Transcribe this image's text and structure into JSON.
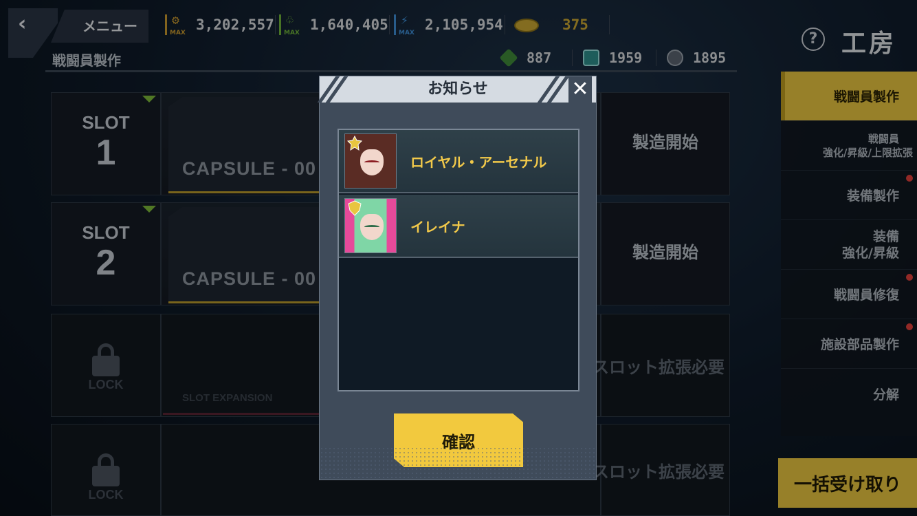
{
  "header": {
    "menu_label": "メニュー",
    "page_title": "工房",
    "subtitle": "戦闘員製作",
    "resources": [
      {
        "icon": "gear-resource-icon",
        "value": "3,202,557",
        "max": "MAX",
        "color": "#c99a2e"
      },
      {
        "icon": "plant-resource-icon",
        "value": "1,640,405",
        "max": "MAX",
        "color": "#6fb23a"
      },
      {
        "icon": "fuel-resource-icon",
        "value": "2,105,954",
        "max": "MAX",
        "color": "#3e8ed6"
      },
      {
        "icon": "coin-icon",
        "value": "375",
        "color": "#c9a632"
      }
    ],
    "resources2": [
      {
        "icon": "green-crystal-icon",
        "value": "887"
      },
      {
        "icon": "chip-icon",
        "value": "1959"
      },
      {
        "icon": "capsule-icon",
        "value": "1895"
      }
    ]
  },
  "slots": [
    {
      "label": "SLOT",
      "number": "1",
      "capsule": "CAPSULE - 00",
      "action": "製造開始"
    },
    {
      "label": "SLOT",
      "number": "2",
      "capsule": "CAPSULE - 00",
      "action": "製造開始"
    },
    {
      "lock": "LOCK",
      "expansion": "SLOT EXPANSION",
      "need": "スロット拡張必要"
    },
    {
      "lock": "LOCK",
      "need": "スロット拡張必要"
    }
  ],
  "side_menu": {
    "items": [
      {
        "label": "戦闘員製作"
      },
      {
        "line1": "戦闘員",
        "line2": "強化/昇級/上限拡張"
      },
      {
        "label": "装備製作"
      },
      {
        "line1": "装備",
        "line2": "強化/昇級"
      },
      {
        "label": "戦闘員修復"
      },
      {
        "label": "施設部品製作"
      },
      {
        "label": "分解"
      }
    ],
    "collect_label": "一括受け取り"
  },
  "modal": {
    "title": "お知らせ",
    "close": "✕",
    "items": [
      {
        "name": "ロイヤル・アーセナル",
        "badge_color": "#e8c540",
        "hair_color": "#5a2c24"
      },
      {
        "name": "イレイナ",
        "badge_color": "#e8c540",
        "hair_color": "#7fd6a6"
      }
    ],
    "confirm_label": "確認"
  },
  "colors": {
    "accent": "#e8c540",
    "notice_dot": "#e0403b"
  }
}
